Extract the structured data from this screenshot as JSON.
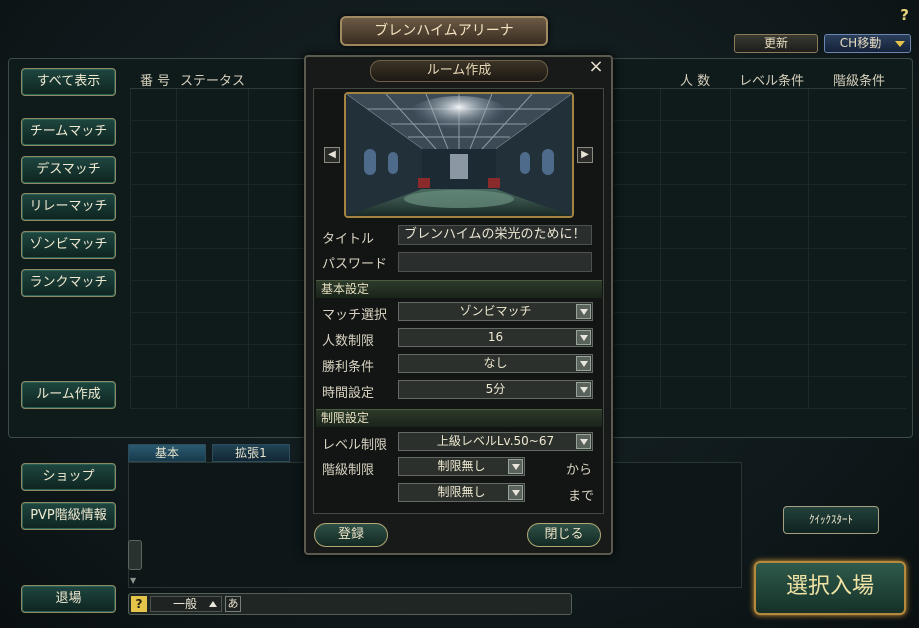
{
  "header": {
    "title": "ブレンハイムアリーナ",
    "help": "?",
    "refresh_label": "更新",
    "channel_label": "CH移動"
  },
  "sidebar": {
    "items": [
      {
        "label": "すべて表示"
      },
      {
        "label": "チームマッチ"
      },
      {
        "label": "デスマッチ"
      },
      {
        "label": "リレーマッチ"
      },
      {
        "label": "ゾンビマッチ"
      },
      {
        "label": "ランクマッチ"
      },
      {
        "label": "ルーム作成"
      }
    ]
  },
  "table": {
    "columns": [
      "番 号",
      "ステータス",
      "人 数",
      "レベル条件",
      "階級条件"
    ]
  },
  "bottom": {
    "shop_label": "ショップ",
    "pvp_label": "PVP階級情報",
    "exit_label": "退場",
    "tabs": [
      {
        "label": "基本"
      },
      {
        "label": "拡張1"
      }
    ],
    "chat": {
      "help": "?",
      "channel": "一般",
      "ime": "あ"
    },
    "quick_start_label": "ｸｲｯｸｽﾀｰﾄ",
    "enter_label": "選択入場"
  },
  "modal": {
    "title": "ルーム作成",
    "close": "×",
    "prev": "◀",
    "next": "▶",
    "title_label": "タイトル",
    "title_value": "ブレンハイムの栄光のために！",
    "password_label": "パスワード",
    "password_value": "",
    "basic_section": "基本設定",
    "match_label": "マッチ選択",
    "match_value": "ゾンビマッチ",
    "players_label": "人数制限",
    "players_value": "16",
    "victory_label": "勝利条件",
    "victory_value": "なし",
    "time_label": "時間設定",
    "time_value": "5分",
    "limit_section": "制限設定",
    "level_label": "レベル制限",
    "level_value": "上級レベルLv.50~67",
    "rank_label": "階級制限",
    "rank_from_value": "制限無し",
    "rank_from_suffix": "から",
    "rank_to_value": "制限無し",
    "rank_to_suffix": "まで",
    "register_label": "登録",
    "close_label": "閉じる"
  }
}
